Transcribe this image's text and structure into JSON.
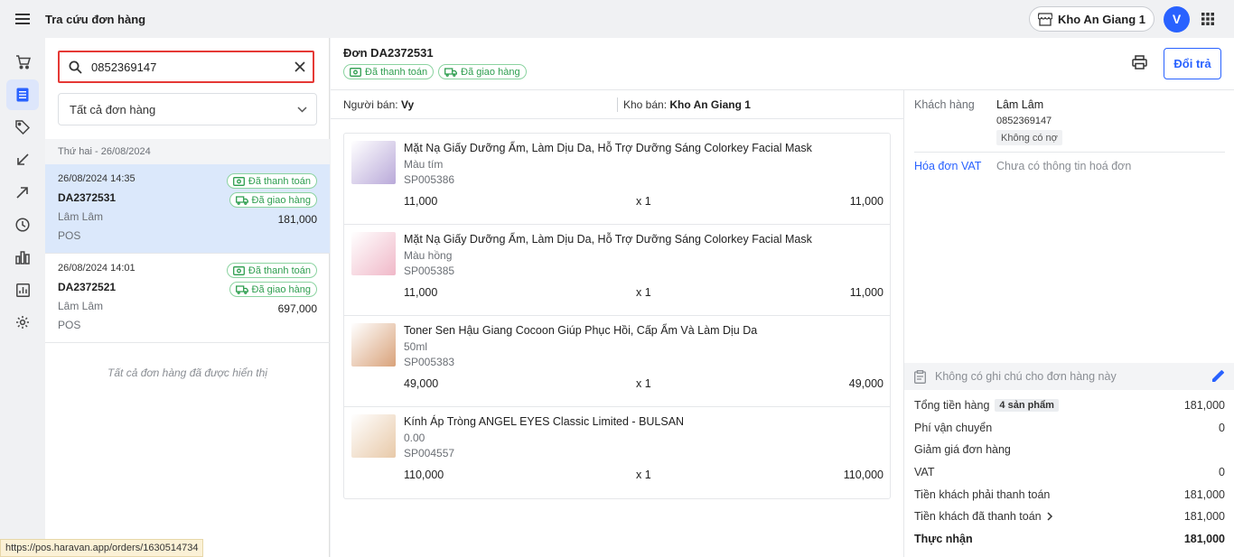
{
  "app": {
    "title": "Tra cứu đơn hàng",
    "store": "Kho An Giang 1",
    "avatar_initial": "V"
  },
  "nav": [
    "cart-icon",
    "orders-icon",
    "tag-icon",
    "import-icon",
    "export-icon",
    "history-icon",
    "bar-chart-icon",
    "report-icon",
    "settings-icon"
  ],
  "search": {
    "value": "0852369147"
  },
  "filter": {
    "selected": "Tất cả đơn hàng"
  },
  "list": {
    "day_header": "Thứ hai - 26/08/2024",
    "orders": [
      {
        "datetime": "26/08/2024 14:35",
        "code": "DA2372531",
        "customer": "Lâm Lâm",
        "source": "POS",
        "total": "181,000",
        "payment": "Đã thanh toán",
        "delivery": "Đã giao hàng"
      },
      {
        "datetime": "26/08/2024 14:01",
        "code": "DA2372521",
        "customer": "Lâm Lâm",
        "source": "POS",
        "total": "697,000",
        "payment": "Đã thanh toán",
        "delivery": "Đã giao hàng"
      }
    ],
    "end_text": "Tất cả đơn hàng đã được hiển thị"
  },
  "status_url": "https://pos.haravan.app/orders/1630514734",
  "detail": {
    "title": "Đơn DA2372531",
    "payment_badge": "Đã thanh toán",
    "delivery_badge": "Đã giao hàng",
    "return_label": "Đổi trả",
    "seller_label": "Người bán:",
    "seller": "Vy",
    "warehouse_label": "Kho bán:",
    "warehouse": "Kho An Giang 1",
    "items": [
      {
        "name": "Mặt Nạ Giấy Dưỡng Ẩm, Làm Dịu Da, Hỗ Trợ Dưỡng Sáng Colorkey Facial Mask",
        "variant": "Màu tím",
        "sku": "SP005386",
        "price": "11,000",
        "qty": "x 1",
        "total": "11,000",
        "thumb_color": "#b9a9d9"
      },
      {
        "name": "Mặt Nạ Giấy Dưỡng Ẩm, Làm Dịu Da, Hỗ Trợ Dưỡng Sáng Colorkey Facial Mask",
        "variant": "Màu hồng",
        "sku": "SP005385",
        "price": "11,000",
        "qty": "x 1",
        "total": "11,000",
        "thumb_color": "#f0b8c8"
      },
      {
        "name": "Toner Sen Hậu Giang Cocoon Giúp Phục Hồi, Cấp Ẩm Và Làm Dịu Da",
        "variant": "50ml",
        "sku": "SP005383",
        "price": "49,000",
        "qty": "x 1",
        "total": "49,000",
        "thumb_color": "#d9a27a"
      },
      {
        "name": "Kính Áp Tròng ANGEL EYES Classic Limited - BULSAN",
        "variant": "0.00",
        "sku": "SP004557",
        "price": "110,000",
        "qty": "x 1",
        "total": "110,000",
        "thumb_color": "#e8c9a8"
      }
    ]
  },
  "side": {
    "customer_label": "Khách hàng",
    "customer_name": "Lâm Lâm",
    "customer_phone": "0852369147",
    "debt_badge": "Không có nợ",
    "vat_label": "Hóa đơn VAT",
    "vat_value": "Chưa có thông tin hoá đơn",
    "note": "Không có ghi chú cho đơn hàng này",
    "summary": {
      "subtotal_label": "Tổng tiền hàng",
      "subtotal_count": "4 sản phẩm",
      "subtotal": "181,000",
      "shipping_label": "Phí vận chuyển",
      "shipping": "0",
      "discount_label": "Giảm giá đơn hàng",
      "discount": "",
      "vat_label": "VAT",
      "vat": "0",
      "due_label": "Tiền khách phải thanh toán",
      "due": "181,000",
      "paid_label": "Tiền khách đã thanh toán",
      "paid": "181,000",
      "net_label": "Thực nhận",
      "net": "181,000"
    }
  },
  "colors": {
    "accent": "#2962ff",
    "success": "#2e9e4f",
    "highlight": "#e53935",
    "selected_bg": "#dbe8fb"
  }
}
